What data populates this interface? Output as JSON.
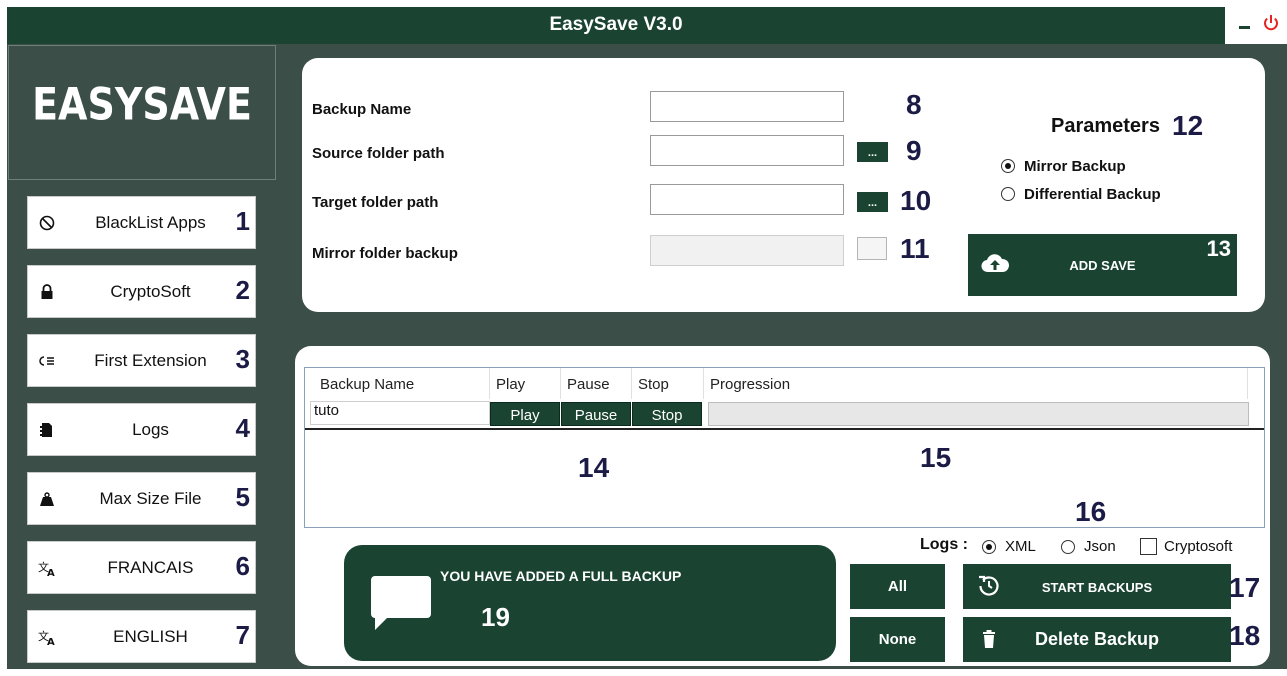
{
  "window": {
    "title": "EasySave V3.0"
  },
  "logo": {
    "text": "EASYSAVE"
  },
  "sidebar": {
    "items": [
      {
        "label": "BlackList Apps",
        "callout": "1",
        "icon": "blocked-icon"
      },
      {
        "label": "CryptoSoft",
        "callout": "2",
        "icon": "lock-icon"
      },
      {
        "label": "First Extension",
        "callout": "3",
        "icon": "extension-list-icon"
      },
      {
        "label": "Logs",
        "callout": "4",
        "icon": "log-file-icon"
      },
      {
        "label": "Max Size File",
        "callout": "5",
        "icon": "weight-icon"
      },
      {
        "label": "FRANCAIS",
        "callout": "6",
        "icon": "translate-icon"
      },
      {
        "label": "ENGLISH",
        "callout": "7",
        "icon": "translate-icon"
      }
    ]
  },
  "form": {
    "backup_name_label": "Backup Name",
    "source_label": "Source folder path",
    "target_label": "Target folder path",
    "mirror_label": "Mirror folder backup",
    "backup_name_value": "",
    "source_value": "",
    "target_value": "",
    "mirror_value": "",
    "browse_label": "...",
    "callouts": {
      "name": "8",
      "source": "9",
      "target": "10",
      "mirror": "11"
    }
  },
  "parameters": {
    "title": "Parameters",
    "callout": "12",
    "options": [
      {
        "label": "Mirror Backup",
        "selected": true
      },
      {
        "label": "Differential Backup",
        "selected": false
      }
    ]
  },
  "add_save": {
    "label": "ADD SAVE",
    "callout": "13"
  },
  "grid": {
    "columns": [
      "Backup Name",
      "Play",
      "Pause",
      "Stop",
      "Progression"
    ],
    "rows": [
      {
        "name": "tuto",
        "play": "Play",
        "pause": "Pause",
        "stop": "Stop",
        "progress": 0
      }
    ],
    "callouts": {
      "a": "14",
      "b": "15"
    }
  },
  "logs": {
    "label": "Logs :",
    "callout": "16",
    "formats": [
      {
        "label": "XML",
        "selected": true
      },
      {
        "label": "Json",
        "selected": false
      }
    ],
    "cryptosoft_label": "Cryptosoft",
    "cryptosoft_checked": false
  },
  "message": {
    "text": "YOU HAVE ADDED A FULL BACKUP",
    "callout": "19"
  },
  "selection": {
    "all_label": "All",
    "none_label": "None"
  },
  "actions": {
    "start_label": "START BACKUPS",
    "start_callout": "17",
    "delete_label": "Delete Backup",
    "delete_callout": "18"
  },
  "colors": {
    "dark_green": "#1a4431",
    "frame": "#3b4f48",
    "callout_navy": "#1b1b46",
    "power_red": "#e52620"
  }
}
